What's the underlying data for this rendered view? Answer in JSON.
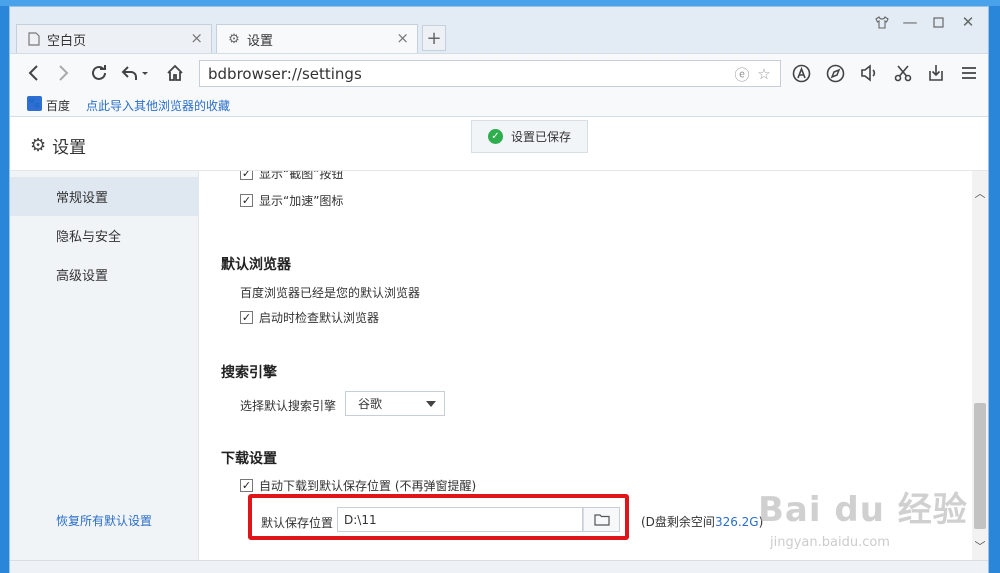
{
  "tabs": [
    {
      "label": "空白页",
      "icon": "page-icon"
    },
    {
      "label": "设置",
      "icon": "gear-icon"
    }
  ],
  "toolbar": {
    "address": "bdbrowser://settings"
  },
  "bookmarks": {
    "logo_label": "百度",
    "import_link": "点此导入其他浏览器的收藏"
  },
  "header": {
    "title": "设置",
    "toast": "设置已保存"
  },
  "sidebar": {
    "items": [
      {
        "label": "常规设置",
        "active": true
      },
      {
        "label": "隐私与安全",
        "active": false
      },
      {
        "label": "高级设置",
        "active": false
      }
    ],
    "restore": "恢复所有默认设置"
  },
  "content": {
    "partial_option": "显示“截图”按钮",
    "speedup_option": "显示“加速”图标",
    "default_browser": {
      "title": "默认浏览器",
      "status": "百度浏览器已经是您的默认浏览器",
      "check_on_start": "启动时检查默认浏览器"
    },
    "search": {
      "title": "搜索引擎",
      "label": "选择默认搜索引擎",
      "selected": "谷歌"
    },
    "download": {
      "title": "下载设置",
      "auto_save": "自动下载到默认保存位置 (不再弹窗提醒)",
      "path_label": "默认保存位置",
      "path_value": "D:\\11",
      "free_prefix": "(D盘剩余空间",
      "free_value": "326.2G",
      "free_suffix": ")"
    }
  },
  "watermark": {
    "brand": "Bai du 经验",
    "url": "jingyan.baidu.com"
  },
  "colors": {
    "accent": "#2a6ec8",
    "highlight": "#e0151a",
    "ok": "#2fae4f"
  }
}
